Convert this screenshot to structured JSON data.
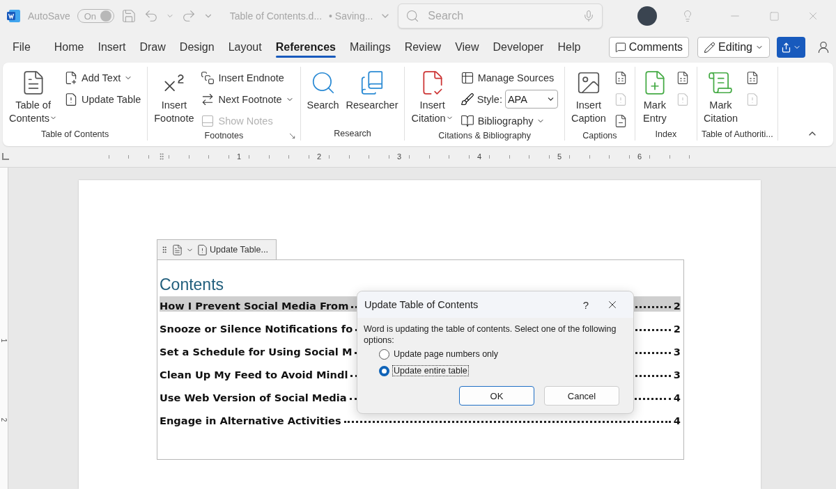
{
  "title_bar": {
    "autosave": "AutoSave",
    "toggle": "On",
    "document": "Table of Contents.d...",
    "status": "• Saving...",
    "search_placeholder": "Search"
  },
  "tabs": [
    {
      "label": "File",
      "selected": false
    },
    {
      "label": "Home",
      "selected": false
    },
    {
      "label": "Insert",
      "selected": false
    },
    {
      "label": "Draw",
      "selected": false
    },
    {
      "label": "Design",
      "selected": false
    },
    {
      "label": "Layout",
      "selected": false
    },
    {
      "label": "References",
      "selected": true
    },
    {
      "label": "Mailings",
      "selected": false
    },
    {
      "label": "Review",
      "selected": false
    },
    {
      "label": "View",
      "selected": false
    },
    {
      "label": "Developer",
      "selected": false
    },
    {
      "label": "Help",
      "selected": false
    }
  ],
  "actions": {
    "comments": "Comments",
    "editing": "Editing"
  },
  "ribbon": {
    "groups": [
      {
        "label": "Table of Contents",
        "launcher": false,
        "items": [
          {
            "kind": "large",
            "label": "Table of\nContents",
            "dropdown": true
          },
          {
            "kind": "small",
            "label": "Add Text",
            "dropdown": true,
            "disabled": false
          },
          {
            "kind": "small",
            "label": "Update Table",
            "dropdown": false,
            "disabled": false
          }
        ]
      },
      {
        "label": "Footnotes",
        "launcher": true,
        "items": [
          {
            "kind": "large",
            "label": "Insert\nFootnote",
            "dropdown": false
          },
          {
            "kind": "small",
            "label": "Insert Endnote",
            "dropdown": false,
            "disabled": false
          },
          {
            "kind": "small",
            "label": "Next Footnote",
            "dropdown": true,
            "disabled": false
          },
          {
            "kind": "small",
            "label": "Show Notes",
            "dropdown": false,
            "disabled": true
          }
        ]
      },
      {
        "label": "Research",
        "launcher": false,
        "items": [
          {
            "kind": "large",
            "label": "Search",
            "dropdown": false
          },
          {
            "kind": "large",
            "label": "Researcher",
            "dropdown": false
          }
        ]
      },
      {
        "label": "Citations & Bibliography",
        "launcher": false,
        "items": [
          {
            "kind": "large",
            "label": "Insert\nCitation",
            "dropdown": true
          },
          {
            "kind": "small",
            "label": "Manage Sources",
            "dropdown": false,
            "disabled": false
          },
          {
            "kind": "select",
            "label": "Style:",
            "value": "APA"
          },
          {
            "kind": "small",
            "label": "Bibliography",
            "dropdown": true,
            "disabled": false
          }
        ]
      },
      {
        "label": "Captions",
        "launcher": false,
        "items": [
          {
            "kind": "large",
            "label": "Insert\nCaption",
            "dropdown": false
          },
          {
            "kind": "icon",
            "disabled": false
          },
          {
            "kind": "icon",
            "disabled": true
          },
          {
            "kind": "icon",
            "disabled": false
          }
        ]
      },
      {
        "label": "Index",
        "launcher": false,
        "items": [
          {
            "kind": "large",
            "label": "Mark\nEntry",
            "dropdown": false
          },
          {
            "kind": "icon",
            "disabled": false
          },
          {
            "kind": "icon",
            "disabled": true
          }
        ]
      },
      {
        "label": "Table of Authoriti...",
        "launcher": false,
        "items": [
          {
            "kind": "large",
            "label": "Mark\nCitation",
            "dropdown": false
          },
          {
            "kind": "icon",
            "disabled": false
          },
          {
            "kind": "icon",
            "disabled": true
          }
        ]
      }
    ]
  },
  "ruler": {
    "marks": [
      "1",
      "2",
      "3",
      "4",
      "5",
      "6"
    ]
  },
  "vertical_ruler": {
    "marks": [
      "1",
      "2"
    ]
  },
  "toc": {
    "control_label": "Update Table...",
    "heading": "Contents",
    "entries": [
      {
        "title": "How I Prevent Social Media From",
        "page": "2",
        "selected": true
      },
      {
        "title": "Snooze or Silence Notifications fo",
        "page": "2",
        "selected": false
      },
      {
        "title": "Set a Schedule for Using Social M",
        "page": "3",
        "selected": false
      },
      {
        "title": "Clean Up My Feed to Avoid Mindl",
        "page": "3",
        "selected": false
      },
      {
        "title": "Use Web Version of Social Media",
        "page": "4",
        "selected": false
      },
      {
        "title": "Engage in Alternative Activities",
        "page": "4",
        "selected": false
      }
    ]
  },
  "dialog": {
    "title": "Update Table of Contents",
    "help": "?",
    "message": "Word is updating the table of contents.  Select one of the following options:",
    "options": [
      {
        "label": "Update page numbers only",
        "selected": false
      },
      {
        "label": "Update entire table",
        "selected": true
      }
    ],
    "buttons": [
      {
        "label": "OK",
        "default": true
      },
      {
        "label": "Cancel",
        "default": false
      }
    ]
  }
}
